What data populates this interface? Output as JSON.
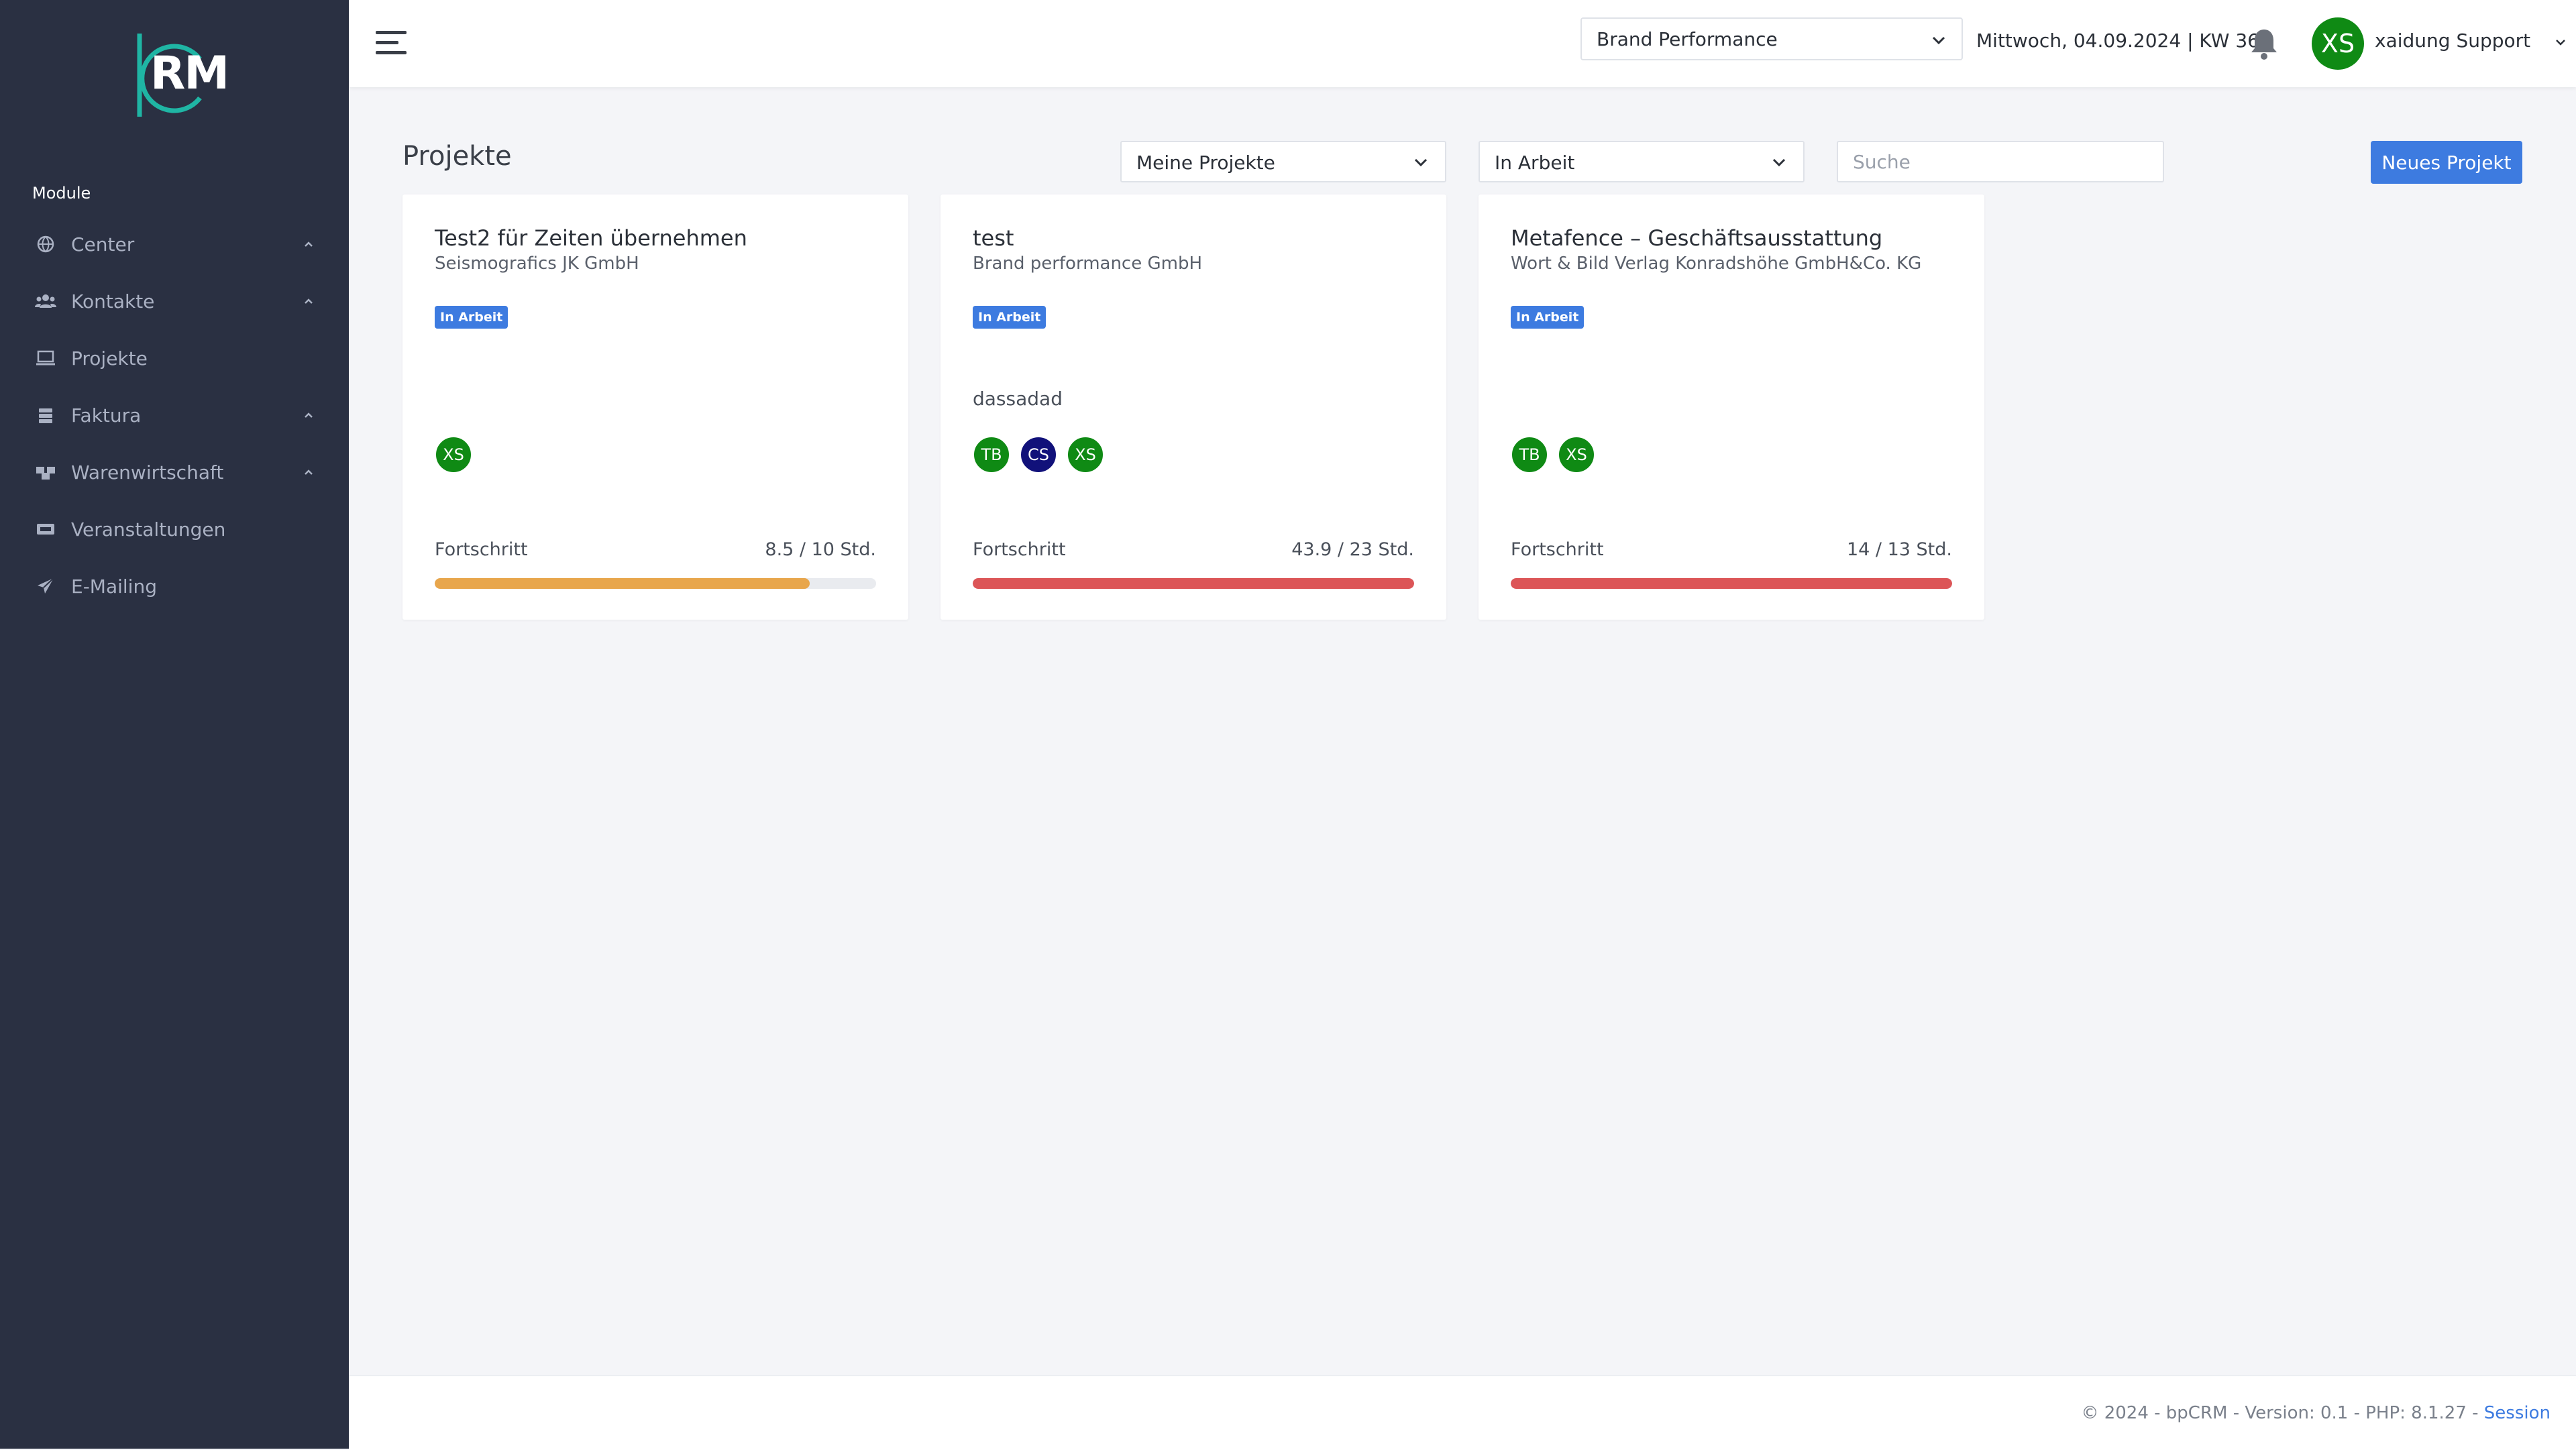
{
  "colors": {
    "sidebar_bg": "#2a3042",
    "accent": "#3d7be0",
    "avatar_green": "#0f8a14",
    "avatar_navy": "#11117a",
    "progress_orange": "#e8a64c",
    "progress_red": "#dc5557",
    "logo_teal": "#1fb5a4"
  },
  "sidebar": {
    "logo_text": "RM",
    "module_heading": "Module",
    "items": [
      {
        "label": "Center",
        "icon": "globe-icon",
        "expandable": true
      },
      {
        "label": "Kontakte",
        "icon": "users-icon",
        "expandable": true
      },
      {
        "label": "Projekte",
        "icon": "laptop-icon",
        "expandable": false
      },
      {
        "label": "Faktura",
        "icon": "money-stack-icon",
        "expandable": true
      },
      {
        "label": "Warenwirtschaft",
        "icon": "boxes-icon",
        "expandable": true
      },
      {
        "label": "Veranstaltungen",
        "icon": "ticket-icon",
        "expandable": false
      },
      {
        "label": "E-Mailing",
        "icon": "paper-plane-icon",
        "expandable": false
      }
    ]
  },
  "header": {
    "company_select": "Brand Performance",
    "date": "Mittwoch, 04.09.2024 | KW 36",
    "user_initials": "XS",
    "user_name": "xaidung Support"
  },
  "toolbar": {
    "title": "Projekte",
    "filter_scope": "Meine Projekte",
    "filter_status": "In Arbeit",
    "search_placeholder": "Suche",
    "new_button": "Neues Projekt"
  },
  "projects": [
    {
      "title": "Test2 für Zeiten übernehmen",
      "company": "Seismografics JK GmbH",
      "status": "In Arbeit",
      "description": "",
      "members": [
        {
          "initials": "XS",
          "color": "#0f8a14"
        }
      ],
      "progress_label": "Fortschritt",
      "progress_text": "8.5 / 10 Std.",
      "progress_ratio": 0.85,
      "progress_color": "#e8a64c"
    },
    {
      "title": "test",
      "company": "Brand performance GmbH",
      "status": "In Arbeit",
      "description": "dassadad",
      "members": [
        {
          "initials": "TB",
          "color": "#0f8a14"
        },
        {
          "initials": "CS",
          "color": "#11117a"
        },
        {
          "initials": "XS",
          "color": "#0f8a14"
        }
      ],
      "progress_label": "Fortschritt",
      "progress_text": "43.9 / 23 Std.",
      "progress_ratio": 1.0,
      "progress_color": "#dc5557"
    },
    {
      "title": "Metafence – Geschäftsausstattung",
      "company": "Wort & Bild Verlag Konradshöhe GmbH&Co. KG",
      "status": "In Arbeit",
      "description": "",
      "members": [
        {
          "initials": "TB",
          "color": "#0f8a14"
        },
        {
          "initials": "XS",
          "color": "#0f8a14"
        }
      ],
      "progress_label": "Fortschritt",
      "progress_text": "14 / 13 Std.",
      "progress_ratio": 1.0,
      "progress_color": "#dc5557"
    }
  ],
  "footer": {
    "text": "© 2024 - bpCRM - Version: 0.1 - PHP: 8.1.27 - ",
    "link": "Session"
  }
}
